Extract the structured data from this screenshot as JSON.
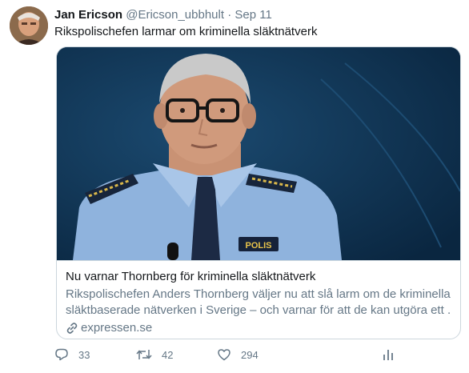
{
  "tweet": {
    "author_name": "Jan Ericson",
    "author_handle": "@Ericson_ubbhult",
    "separator": "·",
    "date": "Sep 11",
    "text": "Rikspolischefen larmar om kriminella släktnätverk"
  },
  "card": {
    "title": "Nu varnar Thornberg för kriminella släktnätverk",
    "description_line1": "Rikspolischefen Anders Thornberg väljer nu att slå larm om de kriminella",
    "description_line2": "släktbaserade nätverken i Sverige – och varnar för att de kan utgöra ett ...",
    "domain": "expressen.se",
    "image_patch_text": "POLIS"
  },
  "actions": {
    "reply_count": "33",
    "retweet_count": "42",
    "like_count": "294",
    "icons": [
      "reply-icon",
      "retweet-icon",
      "like-icon",
      "analytics-icon"
    ]
  },
  "colors": {
    "text": "#14171a",
    "secondary": "#657786",
    "border": "#ccd6dd",
    "image_background": "#0d3150"
  }
}
